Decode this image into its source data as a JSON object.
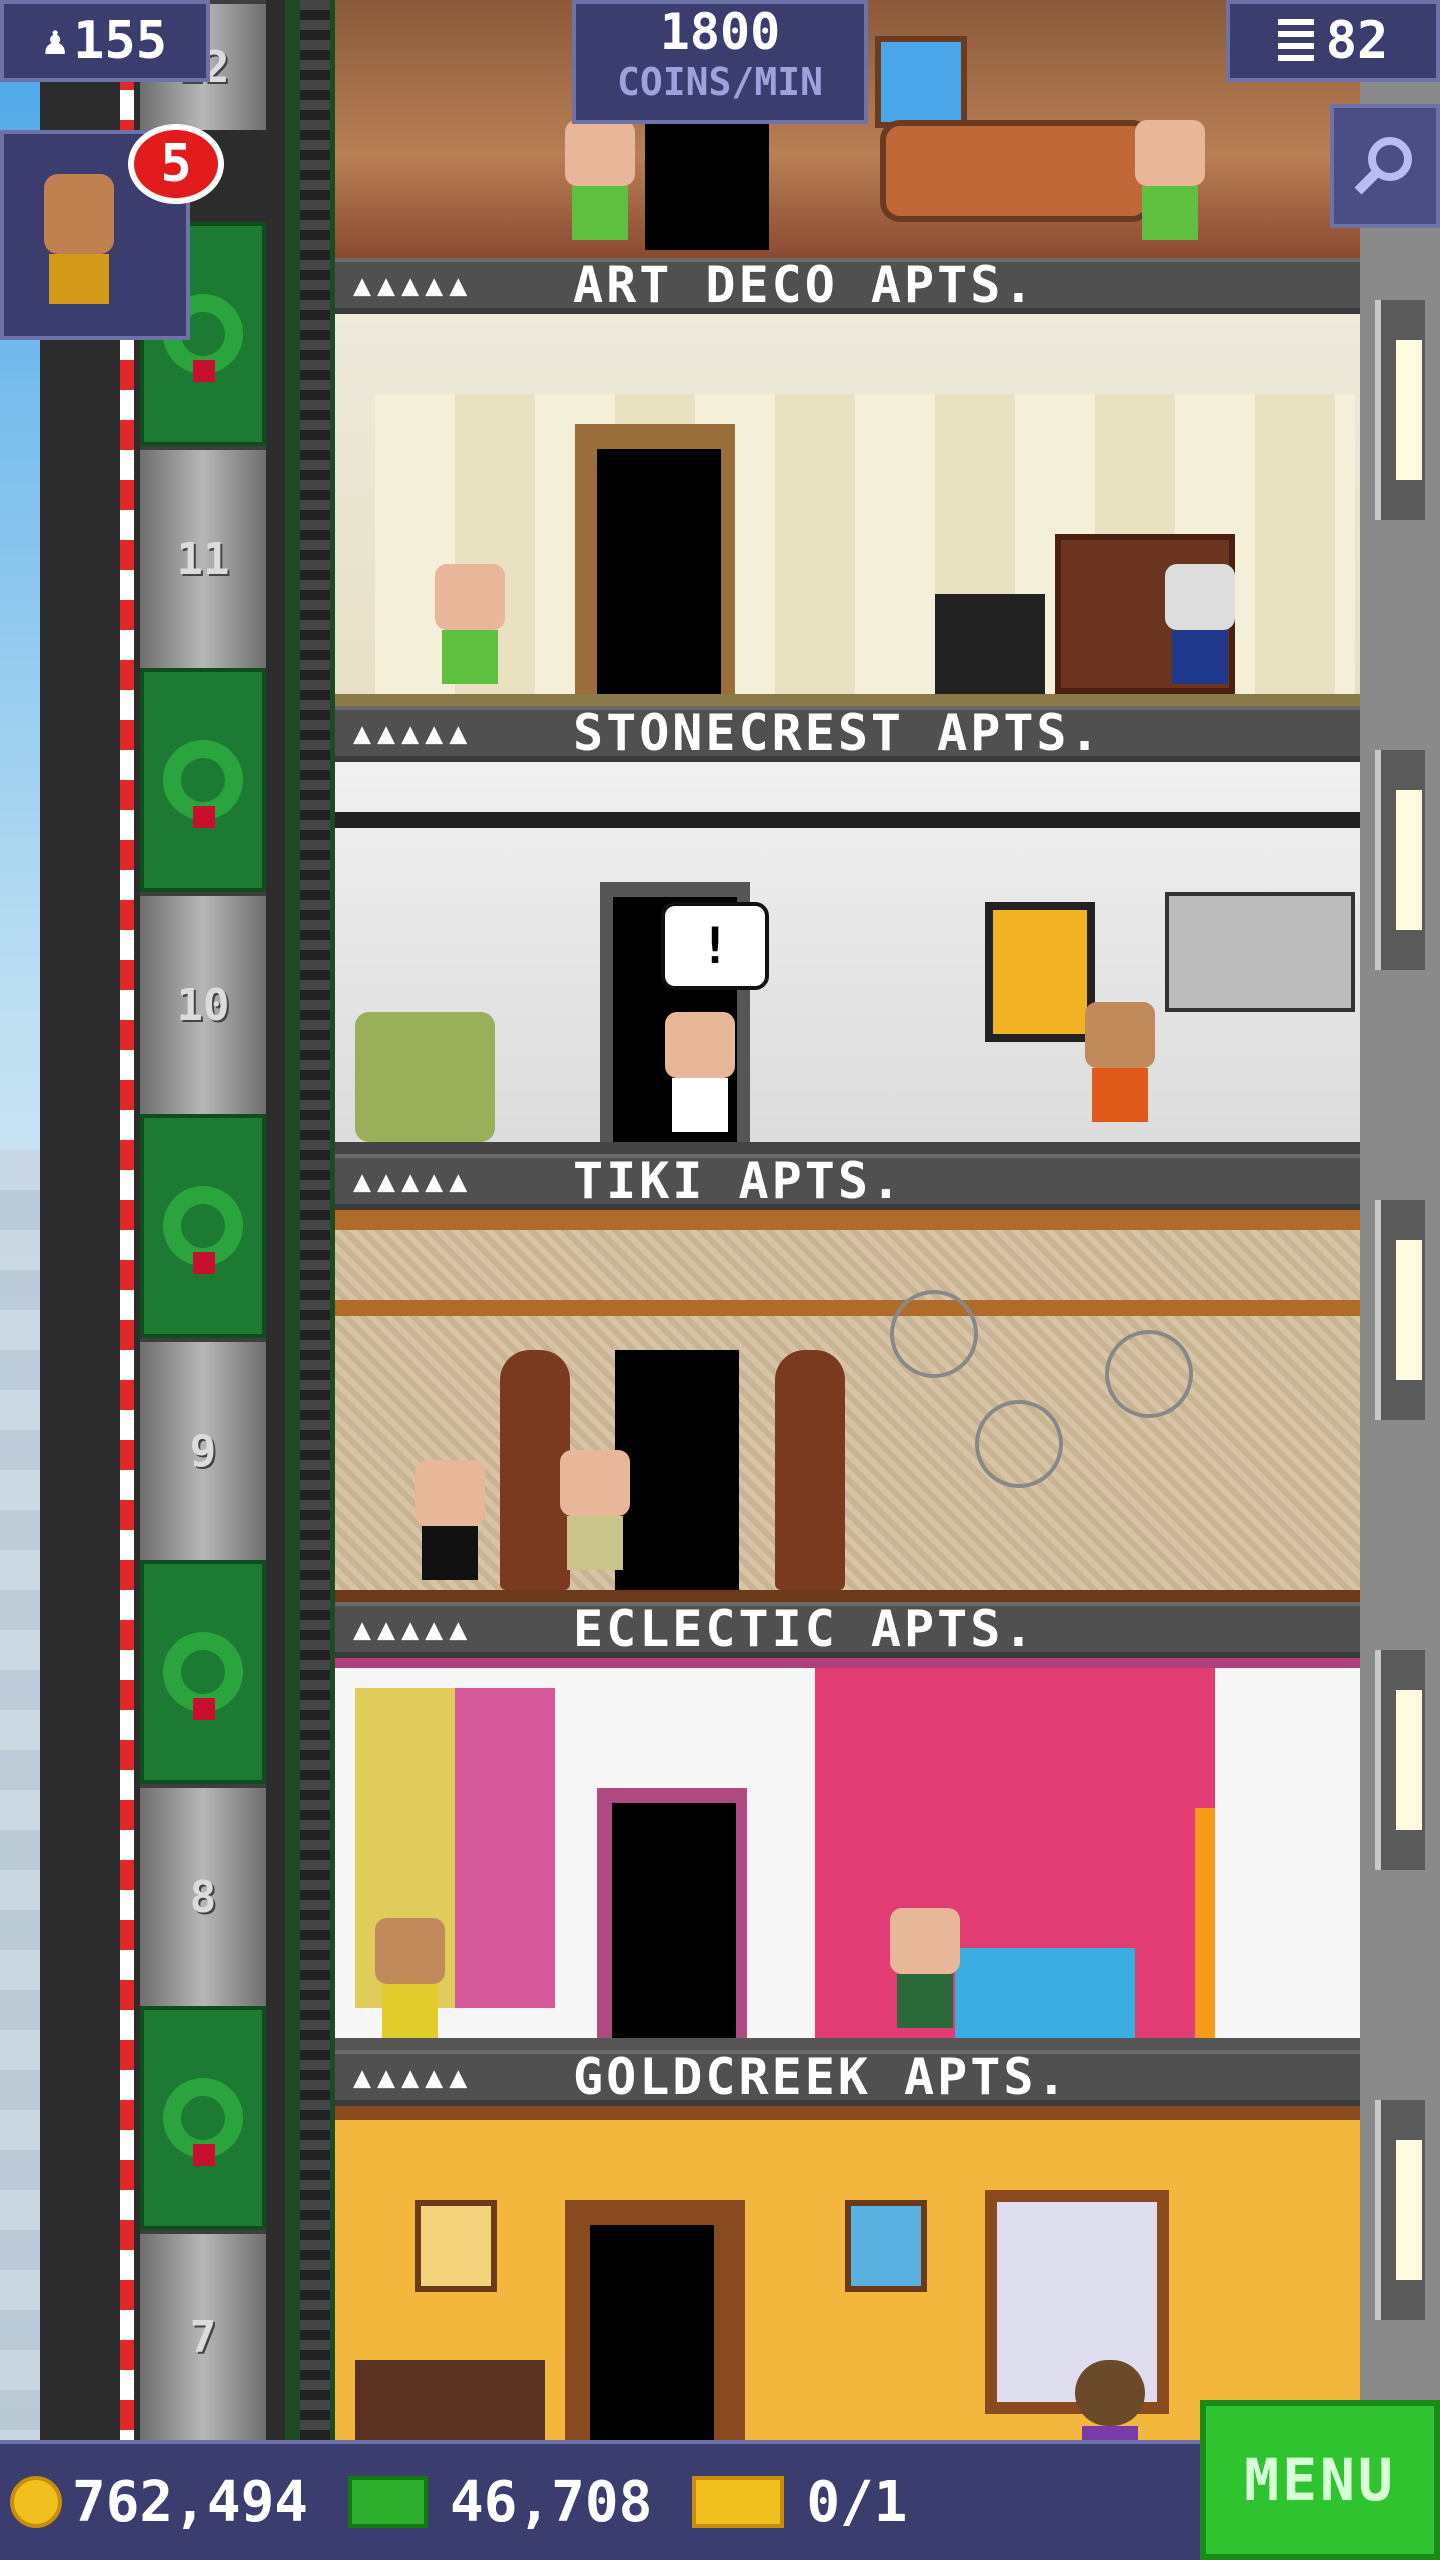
{
  "hud": {
    "population": "155",
    "coins_per_min_value": "1800",
    "coins_per_min_label": "COINS/MIN",
    "floors_count": "82",
    "visitor_badge": "5"
  },
  "floors": [
    {
      "name": "ART DECO APTS.",
      "people": "▲▲▲▲▲"
    },
    {
      "name": "STONECREST APTS.",
      "people": "▲▲▲▲▲"
    },
    {
      "name": "TIKI APTS.",
      "people": "▲▲▲▲▲"
    },
    {
      "name": "ECLECTIC APTS.",
      "people": "▲▲▲▲▲"
    },
    {
      "name": "GOLDCREEK APTS.",
      "people": "▲▲▲▲▲"
    }
  ],
  "elevator": {
    "floor_numbers": [
      "12",
      "11",
      "10",
      "9",
      "8",
      "7"
    ]
  },
  "bubble": "!",
  "bottom": {
    "coins": "762,494",
    "bux": "46,708",
    "tickets": "0/1",
    "menu_label": "MENU"
  },
  "colors": {
    "accent": "#3a3d6e",
    "menu": "#2fc42f"
  }
}
